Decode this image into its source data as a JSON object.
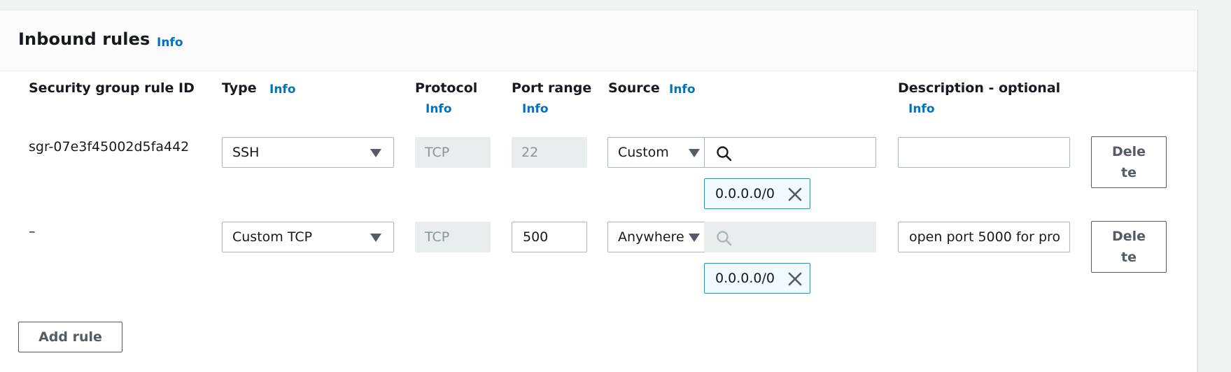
{
  "panel": {
    "title": "Inbound rules",
    "info": "Info"
  },
  "columns": {
    "rule_id": "Security group rule ID",
    "type": "Type",
    "type_info": "Info",
    "protocol": "Protocol",
    "protocol_info": "Info",
    "port_range": "Port range",
    "port_range_info": "Info",
    "source": "Source",
    "source_info": "Info",
    "description": "Description - optional",
    "description_info": "Info"
  },
  "rows": [
    {
      "rule_id": "sgr-07e3f45002d5fa442",
      "type": "SSH",
      "protocol": "TCP",
      "port_range": "22",
      "source_type": "Custom",
      "source_search": "",
      "source_token": "0.0.0.0/0",
      "description": "",
      "delete_label": "Delete"
    },
    {
      "rule_id": "–",
      "type": "Custom TCP",
      "protocol": "TCP",
      "port_range": "500",
      "source_type": "Anywhere",
      "source_search": "",
      "source_token": "0.0.0.0/0",
      "description": "open port 5000 for pro",
      "delete_label": "Delete"
    }
  ],
  "actions": {
    "add_rule": "Add rule"
  },
  "icons": {
    "search": "search-icon",
    "remove": "close-icon",
    "caret": "caret-down-icon"
  },
  "colors": {
    "link": "#0073bb",
    "token_border": "#00a1c9",
    "token_bg": "#f1faff",
    "disabled_bg": "#eaeded"
  }
}
